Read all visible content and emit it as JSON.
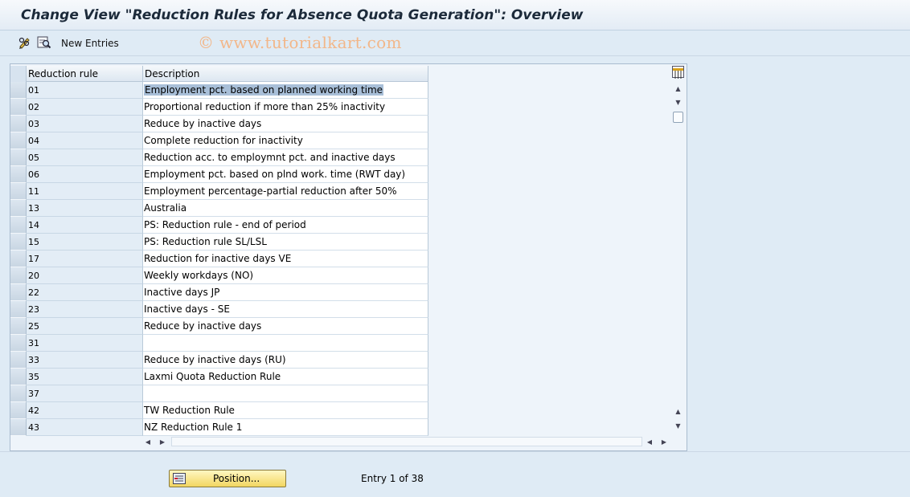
{
  "window": {
    "title": "Change View \"Reduction Rules for Absence Quota Generation\": Overview"
  },
  "toolbar": {
    "edit_icon": "pencil-glasses-icon",
    "find_icon": "find-icon",
    "new_entries_label": "New Entries"
  },
  "watermark": "© www.tutorialkart.com",
  "table": {
    "columns": [
      "Reduction rule",
      "Description"
    ],
    "highlighted_row": 0,
    "rows": [
      {
        "rule": "01",
        "description": "Employment pct. based on planned working time"
      },
      {
        "rule": "02",
        "description": "Proportional reduction if more than 25% inactivity"
      },
      {
        "rule": "03",
        "description": "Reduce by inactive days"
      },
      {
        "rule": "04",
        "description": "Complete reduction for inactivity"
      },
      {
        "rule": "05",
        "description": "Reduction acc. to employmnt pct. and inactive days"
      },
      {
        "rule": "06",
        "description": "Employment pct. based on plnd work. time (RWT day)"
      },
      {
        "rule": "11",
        "description": "Employment percentage-partial reduction after 50%"
      },
      {
        "rule": "13",
        "description": "Australia"
      },
      {
        "rule": "14",
        "description": "PS: Reduction rule - end of period"
      },
      {
        "rule": "15",
        "description": "PS: Reduction rule SL/LSL"
      },
      {
        "rule": "17",
        "description": "Reduction for inactive days VE"
      },
      {
        "rule": "20",
        "description": "Weekly workdays (NO)"
      },
      {
        "rule": "22",
        "description": "Inactive days JP"
      },
      {
        "rule": "23",
        "description": "Inactive days - SE"
      },
      {
        "rule": "25",
        "description": "Reduce by inactive days"
      },
      {
        "rule": "31",
        "description": ""
      },
      {
        "rule": "33",
        "description": "Reduce by inactive days (RU)"
      },
      {
        "rule": "35",
        "description": "Laxmi Quota Reduction Rule"
      },
      {
        "rule": "37",
        "description": ""
      },
      {
        "rule": "42",
        "description": "TW Reduction Rule"
      },
      {
        "rule": "43",
        "description": "NZ Reduction Rule 1"
      }
    ]
  },
  "footer": {
    "position_label": "Position...",
    "entry_info": "Entry 1 of 38"
  }
}
